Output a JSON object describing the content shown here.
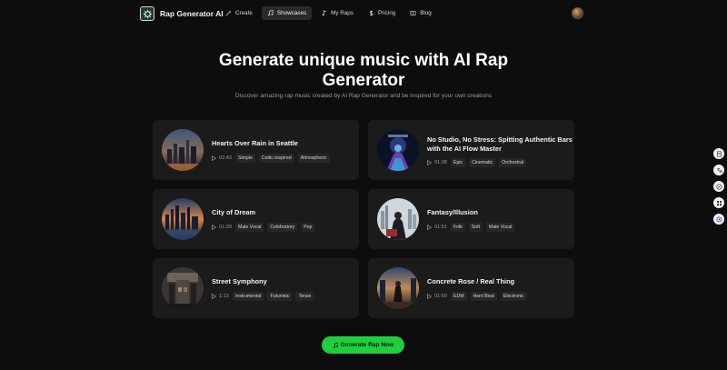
{
  "brand": {
    "name": "Rap Generator AI"
  },
  "nav": [
    {
      "label": "Create",
      "icon": "wand-icon"
    },
    {
      "label": "Showcases",
      "icon": "music-icon",
      "active": true
    },
    {
      "label": "My Raps",
      "icon": "note-icon"
    },
    {
      "label": "Pricing",
      "icon": "dollar-icon"
    },
    {
      "label": "Blog",
      "icon": "book-icon"
    }
  ],
  "hero": {
    "title_line1": "Generate unique music with AI Rap",
    "title_line2": "Generator",
    "subtitle": "Discover amazing rap music created by AI Rap Generator and be inspired for your own creations"
  },
  "tracks": [
    {
      "title": "Hearts Over Rain in Seattle",
      "duration": "02:43",
      "tags": [
        "Simple",
        "Celtic-inspired",
        "Atmospheric"
      ]
    },
    {
      "title_line1": "No Studio, No Stress: Spitting Authentic Bars",
      "title_line2": "with the AI Flow Master",
      "duration": "01:38",
      "tags": [
        "Epic",
        "Cinematic",
        "Orchestral"
      ]
    },
    {
      "title": "City of Dream",
      "duration": "01:29",
      "tags": [
        "Male Vocal",
        "Celebratory",
        "Pop"
      ]
    },
    {
      "title": "Fantasy/Illusion",
      "duration": "01:51",
      "tags": [
        "Folk",
        "Soft",
        "Male Vocal"
      ]
    },
    {
      "title": "Street Symphony",
      "duration": "1:13",
      "tags": [
        "Instrumental",
        "Futuristic",
        "Tense"
      ]
    },
    {
      "title": "Concrete Rose / Real Thing",
      "duration": "01:50",
      "tags": [
        "EDM",
        "Hard Beat",
        "Electronic"
      ]
    }
  ],
  "cta": {
    "label": "Generate Rap Now"
  },
  "colors": {
    "accent": "#1fcf3e",
    "card_bg": "#1b1b1b",
    "page_bg": "#0d0d0d"
  }
}
